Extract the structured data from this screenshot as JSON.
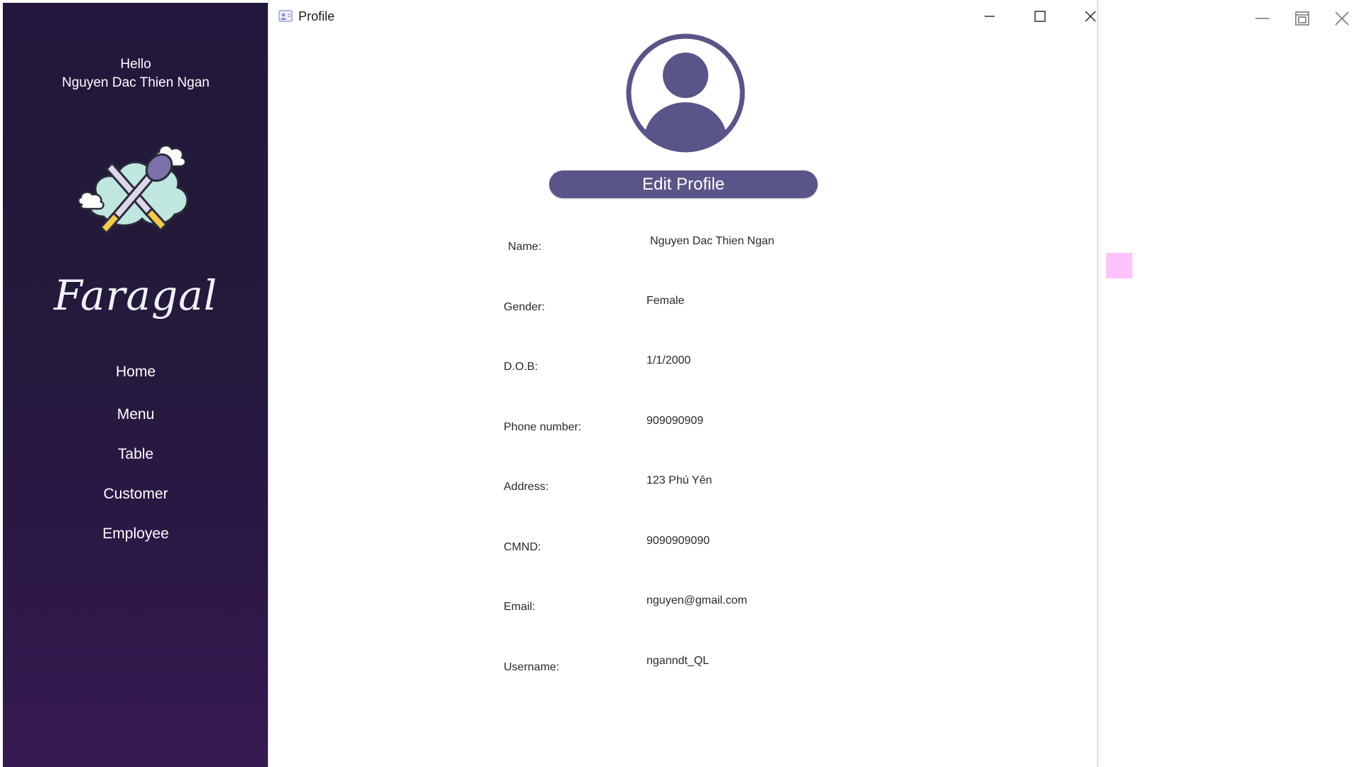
{
  "main_window": {
    "controls": [
      "minimize-icon",
      "restore-icon",
      "close-icon"
    ]
  },
  "sidebar": {
    "greeting_line1": "Hello",
    "greeting_line2": "Nguyen Dac Thien Ngan",
    "brand": "Faragal",
    "nav": [
      {
        "label": "Home"
      },
      {
        "label": "Menu"
      },
      {
        "label": "Table"
      },
      {
        "label": "Customer"
      },
      {
        "label": "Employee"
      }
    ]
  },
  "dialog": {
    "title": "Profile",
    "edit_button": "Edit Profile",
    "fields": [
      {
        "label": "Name:",
        "value": "Nguyen Dac Thien Ngan"
      },
      {
        "label": "Gender:",
        "value": "Female"
      },
      {
        "label": "D.O.B:",
        "value": "1/1/2000"
      },
      {
        "label": "Phone number:",
        "value": "909090909"
      },
      {
        "label": "Address:",
        "value": "123 Phú Yên"
      },
      {
        "label": "CMND:",
        "value": "9090909090"
      },
      {
        "label": "Email:",
        "value": "nguyen@gmail.com"
      },
      {
        "label": "Username:",
        "value": "nganndt_QL"
      }
    ]
  },
  "colors": {
    "sidebar_top": "#23173d",
    "sidebar_bottom": "#371a52",
    "accent": "#5a5588",
    "pink_marker": "#ffc2fb"
  }
}
